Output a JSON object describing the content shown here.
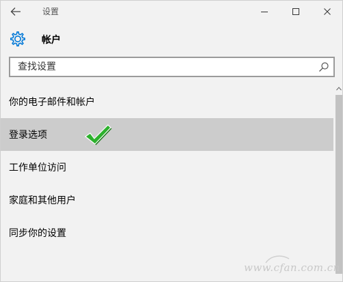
{
  "window": {
    "title": "设置"
  },
  "header": {
    "title": "帐户",
    "icon": "gear-icon"
  },
  "search": {
    "placeholder": "查找设置",
    "value": ""
  },
  "nav": {
    "items": [
      {
        "label": "你的电子邮件和帐户",
        "selected": false
      },
      {
        "label": "登录选项",
        "selected": true
      },
      {
        "label": "工作单位访问",
        "selected": false
      },
      {
        "label": "家庭和其他用户",
        "selected": false
      },
      {
        "label": "同步你的设置",
        "selected": false
      }
    ]
  },
  "watermark": {
    "text": "www.cfan.com.cn"
  },
  "colors": {
    "accent": "#0078d7",
    "selected_bg": "#cccccc",
    "check_green": "#2db12d"
  }
}
